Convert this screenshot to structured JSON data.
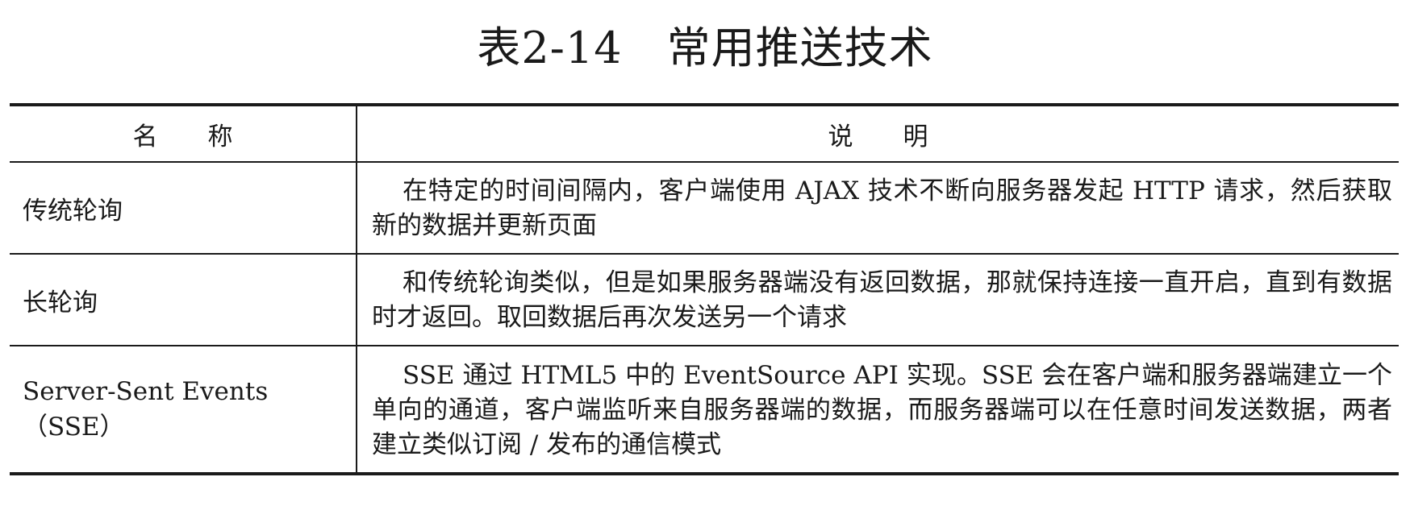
{
  "title": "表2-14　常用推送技术",
  "table": {
    "headers": [
      "名　　称",
      "说　　明"
    ],
    "rows": [
      {
        "name": "传统轮询",
        "description": "在特定的时间间隔内，客户端使用 AJAX 技术不断向服务器发起 HTTP 请求，然后获取新的数据并更新页面"
      },
      {
        "name": "长轮询",
        "description": "和传统轮询类似，但是如果服务器端没有返回数据，那就保持连接一直开启，直到有数据时才返回。取回数据后再次发送另一个请求"
      },
      {
        "name": "Server-Sent Events（SSE）",
        "description": "SSE 通过 HTML5 中的 EventSource API 实现。SSE 会在客户端和服务器端建立一个单向的通道，客户端监听来自服务器端的数据，而服务器端可以在任意时间发送数据，两者建立类似订阅 / 发布的通信模式"
      }
    ]
  }
}
